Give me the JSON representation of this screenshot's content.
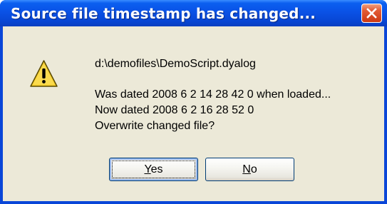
{
  "dialog": {
    "title": "Source file timestamp has changed...",
    "file_path": "d:\\demofiles\\DemoScript.dyalog",
    "was_dated": "Was dated  2008 6 2 14 28 42 0  when loaded...",
    "now_dated": "Now dated  2008 6 2 16 28 52 0",
    "question": "Overwrite changed file?",
    "icon": "warning-icon",
    "buttons": {
      "yes_mnemonic": "Y",
      "yes_rest": "es",
      "no_mnemonic": "N",
      "no_rest": "o"
    }
  },
  "colors": {
    "titlebar": "#0a52e6",
    "close_button": "#e25b35",
    "client_background": "#ece9d8",
    "warning_fill": "#f8d030"
  }
}
